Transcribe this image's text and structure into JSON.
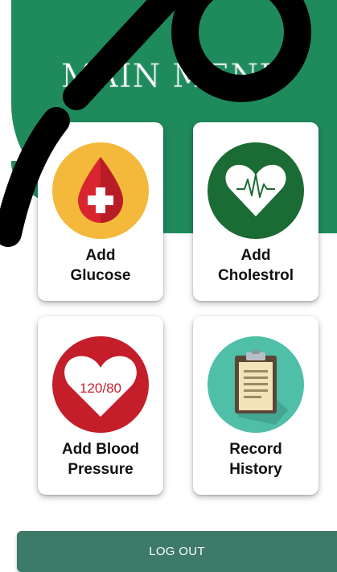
{
  "header": {
    "title": "MAIN MENU"
  },
  "menu": {
    "glucose": {
      "label": "Add\nGlucose",
      "icon": "blood-drop-icon"
    },
    "cholesterol": {
      "label": "Add\nCholestrol",
      "icon": "heart-pulse-icon"
    },
    "blood_pressure": {
      "label": "Add Blood\nPressure",
      "icon": "heart-bp-icon",
      "icon_text": "120/80"
    },
    "history": {
      "label": "Record\nHistory",
      "icon": "clipboard-icon"
    }
  },
  "footer": {
    "logout_label": "LOG OUT"
  },
  "colors": {
    "header": "#1f8a5c",
    "glucose": "#f4b93a",
    "cholesterol": "#1b6b35",
    "blood_pressure": "#c41e2a",
    "history": "#4fbfa8",
    "logout": "#3d7a68"
  }
}
